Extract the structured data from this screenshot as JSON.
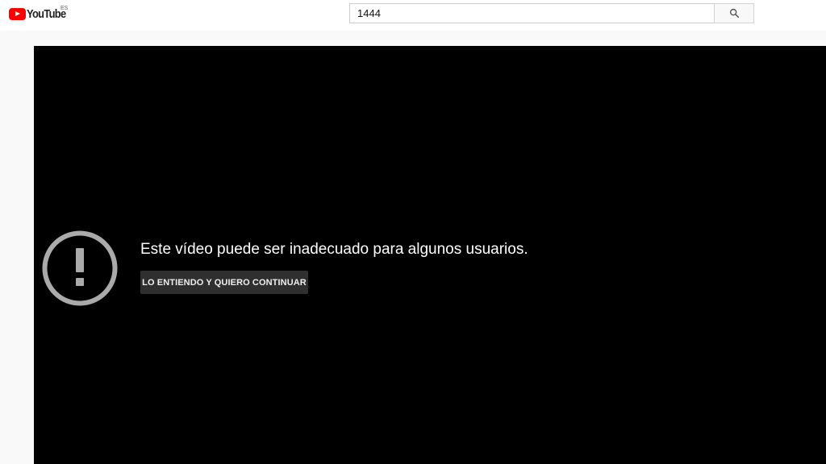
{
  "masthead": {
    "logo_text": "YouTube",
    "country_code": "ES",
    "search": {
      "value": "1444",
      "icon": "search-icon"
    }
  },
  "player": {
    "warning": {
      "icon": "exclamation-circle-icon",
      "message": "Este vídeo puede ser inadecuado para algunos usuarios.",
      "button_label": "LO ENTIENDO Y QUIERO CONTINUAR"
    }
  },
  "colors": {
    "brand_red": "#ff0000",
    "player_background": "#000000",
    "page_background": "#f9f9f9",
    "warning_icon": "#aaaaaa",
    "button_background": "#2f2f2f"
  }
}
